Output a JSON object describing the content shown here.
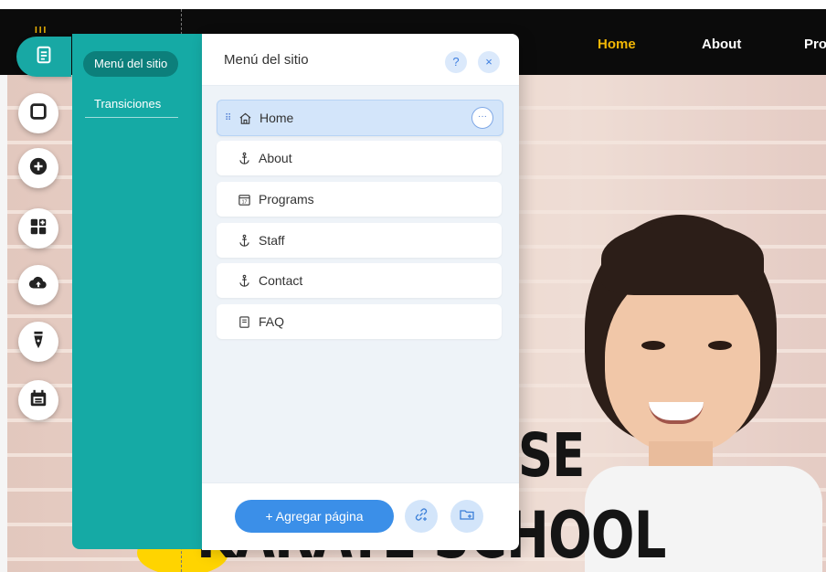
{
  "site": {
    "nav": [
      "Home",
      "About",
      "Pro"
    ],
    "hero_line1": "SE",
    "hero_line2": "KARATE SCHOOL"
  },
  "rail": {
    "items": [
      "pages-icon",
      "section-icon",
      "add-icon",
      "apps-icon",
      "upload-icon",
      "pen-icon",
      "calendar-icon"
    ]
  },
  "side_menu": {
    "items": [
      "Menú del sitio",
      "Transiciones"
    ]
  },
  "panel": {
    "title": "Menú del sitio",
    "help_label": "?",
    "close_label": "×",
    "pages": [
      {
        "label": "Home",
        "icon": "home-icon"
      },
      {
        "label": "About",
        "icon": "anchor-icon"
      },
      {
        "label": "Programs",
        "icon": "calendar-icon"
      },
      {
        "label": "Staff",
        "icon": "anchor-icon"
      },
      {
        "label": "Contact",
        "icon": "anchor-icon"
      },
      {
        "label": "FAQ",
        "icon": "document-icon"
      }
    ],
    "more_label": "···",
    "add_page_label": "+ Agregar página"
  },
  "colors": {
    "teal": "#15aaa5",
    "primary_blue": "#3b8fe8",
    "nav_active": "#f2b705"
  }
}
